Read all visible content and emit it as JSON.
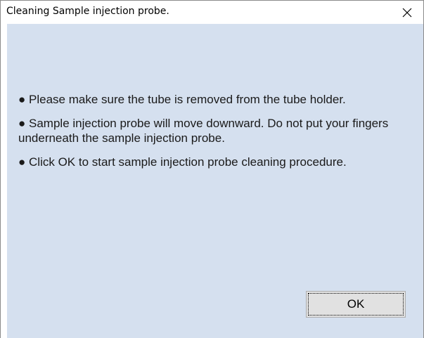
{
  "window": {
    "title": "Cleaning Sample injection probe.",
    "close_glyph": "✕"
  },
  "messages": [
    {
      "bullet": "●",
      "text": "Please make sure the tube is removed from the tube holder."
    },
    {
      "bullet": "●",
      "text": "Sample injection probe will move downward. Do not put your fingers underneath the sample injection probe."
    },
    {
      "bullet": "●",
      "text": "Click OK to start sample injection probe cleaning procedure."
    }
  ],
  "buttons": {
    "ok_label": "OK"
  },
  "colors": {
    "client_background": "#d5e0ef",
    "titlebar_background": "#ffffff",
    "button_background": "#e1e1e1"
  },
  "icons": {
    "close": "close-icon"
  }
}
